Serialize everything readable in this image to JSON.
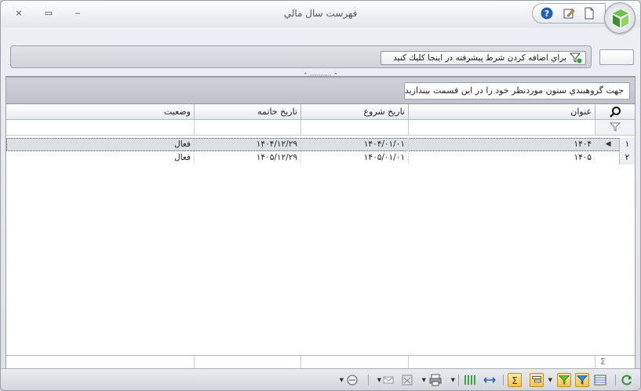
{
  "window": {
    "title": "فهرست سال مالي",
    "close": "×",
    "restore": "▭",
    "minimize": "‒"
  },
  "quick_access": {
    "icons": [
      "new-doc-icon",
      "edit-icon",
      "help-icon"
    ],
    "help_label": "?"
  },
  "filter": {
    "advanced_label": "براي اضافه كردن شرط پيشرفته در اينجا كليك كنيد"
  },
  "splitter": {
    "grip": "⌃ ⋯⋯⋯⋯ ⌃"
  },
  "grid": {
    "group_hint": "جهت گروهبندي ستون موردنظر خود را در اين قسمت بيندازيد",
    "columns": [
      "عنوان",
      "تاريخ شروع",
      "تاريخ خاتمه",
      "وضعيت"
    ],
    "rows": [
      {
        "num": "۱",
        "title": "۱۴۰۴",
        "start": "۱۴۰۴/۰۱/۰۱",
        "end": "۱۴۰۴/۱۲/۲۹",
        "status": "فعال",
        "selected": true
      },
      {
        "num": "۲",
        "title": "۱۴۰۵",
        "start": "۱۴۰۵/۰۱/۰۱",
        "end": "۱۴۰۵/۱۲/۲۹",
        "status": "فعال",
        "selected": false
      }
    ],
    "row_indicator": "◀",
    "footer_sigma": "Σ",
    "search_glyph": "⚲",
    "filter_glyph": "⛛"
  },
  "toolbar": {
    "icons": [
      "refresh-icon",
      "columns-icon",
      "filter-icon",
      "filter-active-icon",
      "group-icon",
      "sum-icon",
      "expand-icon",
      "column-chooser-icon",
      "print-icon",
      "export-icon",
      "mail-icon",
      "zoom-icon"
    ],
    "sum_label": "Σ"
  },
  "colors": {
    "accent": "#f7c24a",
    "selection": "#dcdfe4",
    "border": "#9aa1aa"
  }
}
